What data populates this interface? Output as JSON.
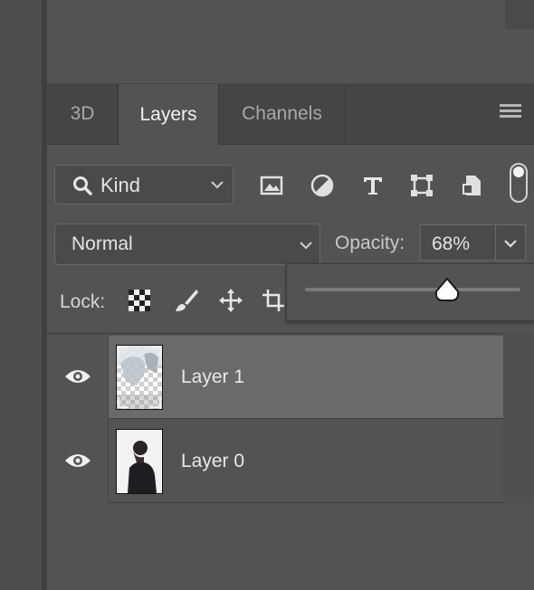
{
  "tabs": [
    {
      "label": "3D",
      "active": false
    },
    {
      "label": "Layers",
      "active": true
    },
    {
      "label": "Channels",
      "active": false
    }
  ],
  "filter": {
    "kind_label": "Kind",
    "icons": [
      "image-filter-icon",
      "adjustment-filter-icon",
      "type-filter-icon",
      "shape-filter-icon",
      "smart-object-filter-icon"
    ]
  },
  "blend": {
    "mode": "Normal",
    "opacity_label": "Opacity:",
    "opacity_value": "68%",
    "opacity_fraction": 0.68
  },
  "lock": {
    "label": "Lock:",
    "icons": [
      "lock-transparent-pixels-icon",
      "lock-image-pixels-icon",
      "lock-position-icon",
      "lock-artboard-icon"
    ]
  },
  "layers": [
    {
      "name": "Layer 1",
      "visible": true,
      "selected": true
    },
    {
      "name": "Layer 0",
      "visible": true,
      "selected": false
    }
  ],
  "colors": {
    "panel_bg": "#535353",
    "selected_row": "#6a6a6a",
    "tab_bar": "#454545"
  }
}
